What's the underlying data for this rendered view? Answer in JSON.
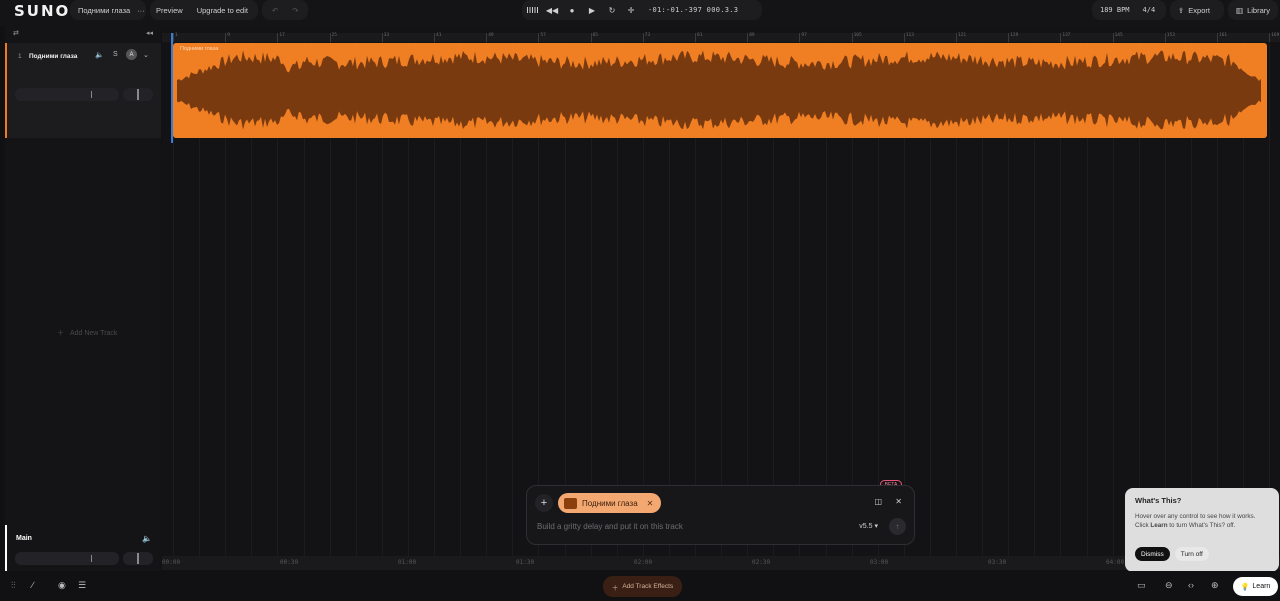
{
  "header": {
    "logo": "SUNO",
    "song_title": "Подними глаза",
    "more_label": "···",
    "preview_label": "Preview",
    "upgrade_label": "Upgrade to edit",
    "timecode": "-01:-01.-397  000.3.3",
    "bpm": "189 BPM",
    "time_signature": "4/4",
    "export_label": "Export",
    "library_label": "Library"
  },
  "tracks": {
    "number": "1",
    "name": "Подними глаза",
    "solo_label": "S",
    "avatar_letter": "A",
    "add_track_label": "Add New Track",
    "main_label": "Main"
  },
  "timeline": {
    "ruler_ticks": [
      "1",
      "9",
      "17",
      "25",
      "33",
      "41",
      "49",
      "57",
      "65",
      "73",
      "81",
      "89",
      "97",
      "105",
      "113",
      "121",
      "129",
      "137",
      "145",
      "153",
      "161",
      "169"
    ],
    "clip_name": "Подними глаза",
    "time_ticks": [
      "00:00",
      "00:30",
      "01:00",
      "01:30",
      "02:00",
      "02:30",
      "03:00",
      "03:30",
      "04:00"
    ]
  },
  "prompt": {
    "beta_label": "BETA",
    "chip_label": "Подними глаза",
    "placeholder": "Build a gritty delay and put it on this track",
    "version": "v5.5"
  },
  "tooltip": {
    "title": "What's This?",
    "text_before": "Hover over any control to see how it works. Click ",
    "text_bold": "Learn",
    "text_after": " to turn What's This? off.",
    "dismiss_label": "Dismiss",
    "turnoff_label": "Turn off"
  },
  "bottom": {
    "effects_label": "Add Track Effects",
    "learn_label": "Learn"
  },
  "colors": {
    "accent_orange": "#f07f24",
    "waveform": "#7a3a10",
    "playhead": "#3a7bd5"
  }
}
